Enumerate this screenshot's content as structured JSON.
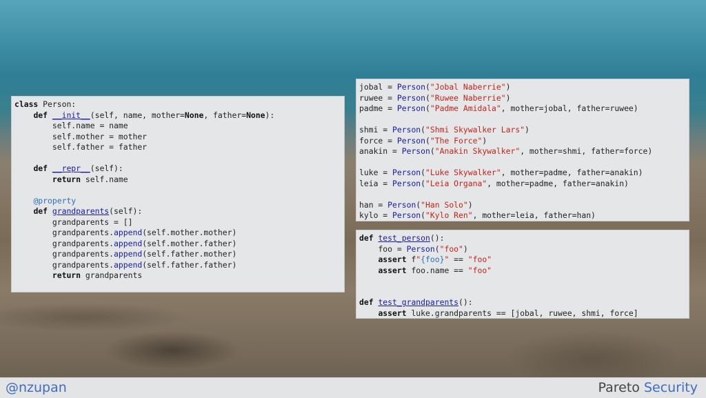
{
  "left_panel": {
    "lines": [
      {
        "indent": "",
        "tokens": [
          {
            "t": "class",
            "c": "kw"
          },
          {
            "t": " Person:",
            "c": ""
          }
        ]
      },
      {
        "indent": "    ",
        "tokens": [
          {
            "t": "def",
            "c": "kw"
          },
          {
            "t": " ",
            "c": ""
          },
          {
            "t": "__init__",
            "c": "fn"
          },
          {
            "t": "(self, name, mother=",
            "c": ""
          },
          {
            "t": "None",
            "c": "kw"
          },
          {
            "t": ", father=",
            "c": ""
          },
          {
            "t": "None",
            "c": "kw"
          },
          {
            "t": "):",
            "c": ""
          }
        ]
      },
      {
        "indent": "        ",
        "tokens": [
          {
            "t": "self.name = name",
            "c": ""
          }
        ]
      },
      {
        "indent": "        ",
        "tokens": [
          {
            "t": "self.mother = mother",
            "c": ""
          }
        ]
      },
      {
        "indent": "        ",
        "tokens": [
          {
            "t": "self.father = father",
            "c": ""
          }
        ]
      },
      {
        "indent": "",
        "tokens": []
      },
      {
        "indent": "    ",
        "tokens": [
          {
            "t": "def",
            "c": "kw"
          },
          {
            "t": " ",
            "c": ""
          },
          {
            "t": "__repr__",
            "c": "fn"
          },
          {
            "t": "(self):",
            "c": ""
          }
        ]
      },
      {
        "indent": "        ",
        "tokens": [
          {
            "t": "return",
            "c": "kw"
          },
          {
            "t": " self.name",
            "c": ""
          }
        ]
      },
      {
        "indent": "",
        "tokens": []
      },
      {
        "indent": "    ",
        "tokens": [
          {
            "t": "@property",
            "c": "deco"
          }
        ]
      },
      {
        "indent": "    ",
        "tokens": [
          {
            "t": "def",
            "c": "kw"
          },
          {
            "t": " ",
            "c": ""
          },
          {
            "t": "grandparents",
            "c": "fn"
          },
          {
            "t": "(self):",
            "c": ""
          }
        ]
      },
      {
        "indent": "        ",
        "tokens": [
          {
            "t": "grandparents = []",
            "c": ""
          }
        ]
      },
      {
        "indent": "        ",
        "tokens": [
          {
            "t": "grandparents.",
            "c": ""
          },
          {
            "t": "append",
            "c": "call"
          },
          {
            "t": "(self.mother.mother)",
            "c": ""
          }
        ]
      },
      {
        "indent": "        ",
        "tokens": [
          {
            "t": "grandparents.",
            "c": ""
          },
          {
            "t": "append",
            "c": "call"
          },
          {
            "t": "(self.mother.father)",
            "c": ""
          }
        ]
      },
      {
        "indent": "        ",
        "tokens": [
          {
            "t": "grandparents.",
            "c": ""
          },
          {
            "t": "append",
            "c": "call"
          },
          {
            "t": "(self.father.mother)",
            "c": ""
          }
        ]
      },
      {
        "indent": "        ",
        "tokens": [
          {
            "t": "grandparents.",
            "c": ""
          },
          {
            "t": "append",
            "c": "call"
          },
          {
            "t": "(self.father.father)",
            "c": ""
          }
        ]
      },
      {
        "indent": "        ",
        "tokens": [
          {
            "t": "return",
            "c": "kw"
          },
          {
            "t": " grandparents",
            "c": ""
          }
        ]
      }
    ]
  },
  "right_top_panel": {
    "lines": [
      {
        "indent": "",
        "tokens": [
          {
            "t": "jobal = ",
            "c": ""
          },
          {
            "t": "Person",
            "c": "call"
          },
          {
            "t": "(",
            "c": ""
          },
          {
            "t": "\"Jobal Naberrie\"",
            "c": "str"
          },
          {
            "t": ")",
            "c": ""
          }
        ]
      },
      {
        "indent": "",
        "tokens": [
          {
            "t": "ruwee = ",
            "c": ""
          },
          {
            "t": "Person",
            "c": "call"
          },
          {
            "t": "(",
            "c": ""
          },
          {
            "t": "\"Ruwee Naberrie\"",
            "c": "str"
          },
          {
            "t": ")",
            "c": ""
          }
        ]
      },
      {
        "indent": "",
        "tokens": [
          {
            "t": "padme = ",
            "c": ""
          },
          {
            "t": "Person",
            "c": "call"
          },
          {
            "t": "(",
            "c": ""
          },
          {
            "t": "\"Padme Amidala\"",
            "c": "str"
          },
          {
            "t": ", mother=jobal, father=ruwee)",
            "c": ""
          }
        ]
      },
      {
        "indent": "",
        "tokens": []
      },
      {
        "indent": "",
        "tokens": [
          {
            "t": "shmi = ",
            "c": ""
          },
          {
            "t": "Person",
            "c": "call"
          },
          {
            "t": "(",
            "c": ""
          },
          {
            "t": "\"Shmi Skywalker Lars\"",
            "c": "str"
          },
          {
            "t": ")",
            "c": ""
          }
        ]
      },
      {
        "indent": "",
        "tokens": [
          {
            "t": "force = ",
            "c": ""
          },
          {
            "t": "Person",
            "c": "call"
          },
          {
            "t": "(",
            "c": ""
          },
          {
            "t": "\"The Force\"",
            "c": "str"
          },
          {
            "t": ")",
            "c": ""
          }
        ]
      },
      {
        "indent": "",
        "tokens": [
          {
            "t": "anakin = ",
            "c": ""
          },
          {
            "t": "Person",
            "c": "call"
          },
          {
            "t": "(",
            "c": ""
          },
          {
            "t": "\"Anakin Skywalker\"",
            "c": "str"
          },
          {
            "t": ", mother=shmi, father=force)",
            "c": ""
          }
        ]
      },
      {
        "indent": "",
        "tokens": []
      },
      {
        "indent": "",
        "tokens": [
          {
            "t": "luke = ",
            "c": ""
          },
          {
            "t": "Person",
            "c": "call"
          },
          {
            "t": "(",
            "c": ""
          },
          {
            "t": "\"Luke Skywalker\"",
            "c": "str"
          },
          {
            "t": ", mother=padme, father=anakin)",
            "c": ""
          }
        ]
      },
      {
        "indent": "",
        "tokens": [
          {
            "t": "leia = ",
            "c": ""
          },
          {
            "t": "Person",
            "c": "call"
          },
          {
            "t": "(",
            "c": ""
          },
          {
            "t": "\"Leia Organa\"",
            "c": "str"
          },
          {
            "t": ", mother=padme, father=anakin)",
            "c": ""
          }
        ]
      },
      {
        "indent": "",
        "tokens": []
      },
      {
        "indent": "",
        "tokens": [
          {
            "t": "han = ",
            "c": ""
          },
          {
            "t": "Person",
            "c": "call"
          },
          {
            "t": "(",
            "c": ""
          },
          {
            "t": "\"Han Solo\"",
            "c": "str"
          },
          {
            "t": ")",
            "c": ""
          }
        ]
      },
      {
        "indent": "",
        "tokens": [
          {
            "t": "kylo = ",
            "c": ""
          },
          {
            "t": "Person",
            "c": "call"
          },
          {
            "t": "(",
            "c": ""
          },
          {
            "t": "\"Kylo Ren\"",
            "c": "str"
          },
          {
            "t": ", mother=leia, father=han)",
            "c": ""
          }
        ]
      }
    ]
  },
  "right_bottom_panel": {
    "lines": [
      {
        "indent": "",
        "tokens": [
          {
            "t": "def",
            "c": "kw"
          },
          {
            "t": " ",
            "c": ""
          },
          {
            "t": "test_person",
            "c": "fn"
          },
          {
            "t": "():",
            "c": ""
          }
        ]
      },
      {
        "indent": "    ",
        "tokens": [
          {
            "t": "foo = ",
            "c": ""
          },
          {
            "t": "Person",
            "c": "call"
          },
          {
            "t": "(",
            "c": ""
          },
          {
            "t": "\"foo\"",
            "c": "str"
          },
          {
            "t": ")",
            "c": ""
          }
        ]
      },
      {
        "indent": "    ",
        "tokens": [
          {
            "t": "assert",
            "c": "kw"
          },
          {
            "t": " f",
            "c": ""
          },
          {
            "t": "\"",
            "c": "str"
          },
          {
            "t": "{foo}",
            "c": "interp"
          },
          {
            "t": "\"",
            "c": "str"
          },
          {
            "t": " == ",
            "c": ""
          },
          {
            "t": "\"foo\"",
            "c": "str"
          }
        ]
      },
      {
        "indent": "    ",
        "tokens": [
          {
            "t": "assert",
            "c": "kw"
          },
          {
            "t": " foo.name == ",
            "c": ""
          },
          {
            "t": "\"foo\"",
            "c": "str"
          }
        ]
      },
      {
        "indent": "",
        "tokens": []
      },
      {
        "indent": "",
        "tokens": []
      },
      {
        "indent": "",
        "tokens": [
          {
            "t": "def",
            "c": "kw"
          },
          {
            "t": " ",
            "c": ""
          },
          {
            "t": "test_grandparents",
            "c": "fn"
          },
          {
            "t": "():",
            "c": ""
          }
        ]
      },
      {
        "indent": "    ",
        "tokens": [
          {
            "t": "assert",
            "c": "kw"
          },
          {
            "t": " luke.grandparents == [jobal, ruwee, shmi, force]",
            "c": ""
          }
        ]
      }
    ]
  },
  "footer": {
    "handle": "@nzupan",
    "brand_part1": "Pareto",
    "brand_part2": "Security"
  },
  "colors": {
    "panel_bg": "#e4e6e8",
    "keyword": "#111111",
    "function": "#1a1aa6",
    "string": "#c4241b",
    "decorator": "#2f6fb5",
    "accent": "#3f6cc0"
  }
}
